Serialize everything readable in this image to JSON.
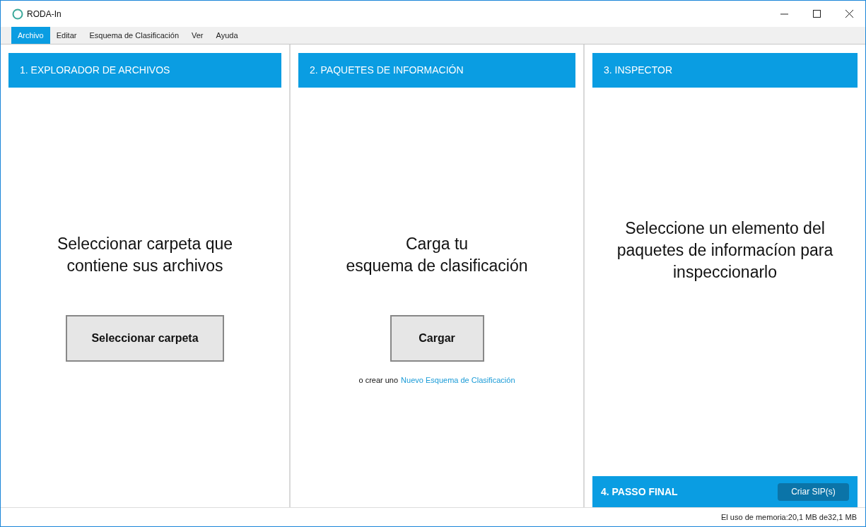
{
  "window": {
    "title": "RODA-In"
  },
  "menu": [
    {
      "label": "Archivo",
      "selected": true
    },
    {
      "label": "Editar",
      "selected": false
    },
    {
      "label": "Esquema de Clasificación",
      "selected": false
    },
    {
      "label": "Ver",
      "selected": false
    },
    {
      "label": "Ayuda",
      "selected": false
    }
  ],
  "panels": [
    {
      "kind": "explorer",
      "header": "1. EXPLORADOR DE ARCHIVOS",
      "message": "Seleccionar carpeta que\ncontiene sus archivos",
      "button": "Seleccionar carpeta"
    },
    {
      "kind": "packages",
      "header": "2. PAQUETES DE INFORMACIÓN",
      "message": "Carga tu\nesquema de clasificación",
      "button": "Cargar",
      "hint": "o crear uno",
      "link": "Nuevo Esquema de Clasificación"
    },
    {
      "kind": "inspector",
      "header": "3. INSPECTOR",
      "message": "Seleccione un elemento del\npaquetes de informacíon para\ninspeccionarlo"
    }
  ],
  "final_step": {
    "header": "4. PASSO FINAL",
    "button": "Criar SIP(s)"
  },
  "status_bar": "El uso de memoria:20,1 MB de32,1 MB"
}
